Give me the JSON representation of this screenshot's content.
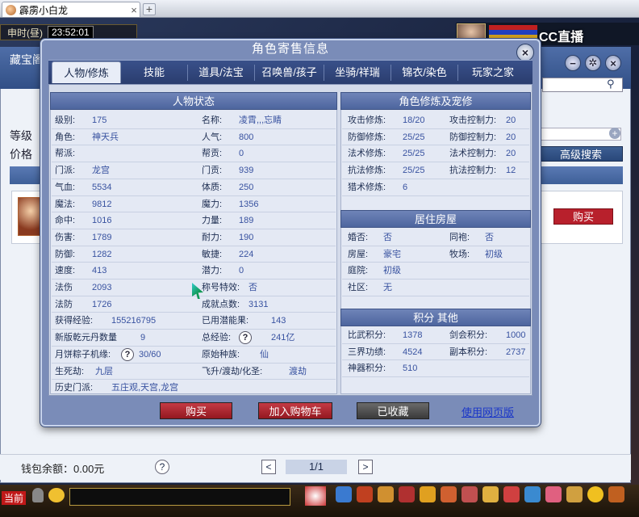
{
  "browser": {
    "tab_title": "霹雳小白龙",
    "close_label": "×",
    "new_tab_label": "+"
  },
  "hud": {
    "period": "申时(昼)",
    "time": "23:52:01",
    "live_badge": "CC直播"
  },
  "back": {
    "title": "藏宝阁",
    "level_label": "等级",
    "price_label": "价格",
    "advanced_search": "高级搜索",
    "buy_label": "购买",
    "wallet": "钱包余额：0.00元",
    "help": "?",
    "page": "1/1",
    "prev": "<",
    "next": ">"
  },
  "bottom": {
    "channel": "当前"
  },
  "modal": {
    "title": "角色寄售信息",
    "close": "×",
    "tabs": [
      "人物/修炼",
      "技能",
      "道具/法宝",
      "召唤兽/孩子",
      "坐骑/祥瑞",
      "锦衣/染色",
      "玩家之家"
    ],
    "status": {
      "header": "人物状态",
      "left": [
        {
          "k": "级别:",
          "v": "175"
        },
        {
          "k": "角色:",
          "v": "神天兵"
        },
        {
          "k": "帮派:",
          "v": ""
        },
        {
          "k": "门派:",
          "v": "龙宫"
        },
        {
          "k": "气血:",
          "v": "5534"
        },
        {
          "k": "魔法:",
          "v": "9812"
        },
        {
          "k": "命中:",
          "v": "1016"
        },
        {
          "k": "伤害:",
          "v": "1789"
        },
        {
          "k": "防御:",
          "v": "1282"
        },
        {
          "k": "速度:",
          "v": "413"
        },
        {
          "k": "法伤",
          "v": "2093"
        },
        {
          "k": "法防",
          "v": "1726"
        }
      ],
      "right": [
        {
          "k": "名称:",
          "v": "凌霄,,,忘睛"
        },
        {
          "k": "人气:",
          "v": "800"
        },
        {
          "k": "帮贡:",
          "v": "0"
        },
        {
          "k": "门贡:",
          "v": "939"
        },
        {
          "k": "体质:",
          "v": "250"
        },
        {
          "k": "魔力:",
          "v": "1356"
        },
        {
          "k": "力量:",
          "v": "189"
        },
        {
          "k": "耐力:",
          "v": "190"
        },
        {
          "k": "敏捷:",
          "v": "224"
        },
        {
          "k": "潜力:",
          "v": "0"
        },
        {
          "k": "称号特效:",
          "v": "否"
        },
        {
          "k": "成就点数:",
          "v": "3131"
        }
      ],
      "exp": {
        "k": "获得经验:",
        "v": "155216795"
      },
      "used_potential": {
        "k": "已用潜能果:",
        "v": "143"
      },
      "qiankun": {
        "k": "新版乾元丹数量",
        "v": "9"
      },
      "total_exp": {
        "k": "总经验:",
        "v": "241亿"
      },
      "mooncake": {
        "k": "月饼粽子机缘:",
        "v": "30/60"
      },
      "race": {
        "k": "原始种族:",
        "v": "仙"
      },
      "life_death": {
        "k": "生死劫:",
        "v": "九层"
      },
      "ascend": {
        "k": "飞升/渡劫/化圣:",
        "v": "渡劫"
      },
      "history": {
        "k": "历史门派:",
        "v": "五庄观,天宫,龙宫"
      },
      "qmark": "?"
    },
    "cultivation": {
      "header": "角色修炼及宠修",
      "rows": [
        [
          {
            "k": "攻击修炼:",
            "v": "18/20"
          },
          {
            "k": "攻击控制力:",
            "v": "20"
          }
        ],
        [
          {
            "k": "防御修炼:",
            "v": "25/25"
          },
          {
            "k": "防御控制力:",
            "v": "20"
          }
        ],
        [
          {
            "k": "法术修炼:",
            "v": "25/25"
          },
          {
            "k": "法术控制力:",
            "v": "20"
          }
        ],
        [
          {
            "k": "抗法修炼:",
            "v": "25/25"
          },
          {
            "k": "抗法控制力:",
            "v": "12"
          }
        ],
        [
          {
            "k": "猎术修炼:",
            "v": "6"
          },
          {
            "k": "",
            "v": ""
          }
        ]
      ]
    },
    "housing": {
      "header": "居住房屋",
      "rows": [
        [
          {
            "k": "婚否:",
            "v": "否"
          },
          {
            "k": "同袍:",
            "v": "否"
          }
        ],
        [
          {
            "k": "房屋:",
            "v": "豪宅"
          },
          {
            "k": "牧场:",
            "v": "初级"
          }
        ],
        [
          {
            "k": "庭院:",
            "v": "初级"
          },
          {
            "k": "",
            "v": ""
          }
        ],
        [
          {
            "k": "社区:",
            "v": "无"
          },
          {
            "k": "",
            "v": ""
          }
        ]
      ]
    },
    "points": {
      "header": "积分 其他",
      "rows": [
        [
          {
            "k": "比武积分:",
            "v": "1378"
          },
          {
            "k": "剑会积分:",
            "v": "1000"
          }
        ],
        [
          {
            "k": "三界功绩:",
            "v": "4524"
          },
          {
            "k": "副本积分:",
            "v": "2737"
          }
        ],
        [
          {
            "k": "神器积分:",
            "v": "510"
          },
          {
            "k": "",
            "v": ""
          }
        ]
      ]
    },
    "buttons": {
      "buy": "购买",
      "add_cart": "加入购物车",
      "favorited": "已收藏",
      "web": "使用网页版"
    }
  },
  "colors": {
    "accent": "#4d659e",
    "buy": "#b8202c"
  }
}
